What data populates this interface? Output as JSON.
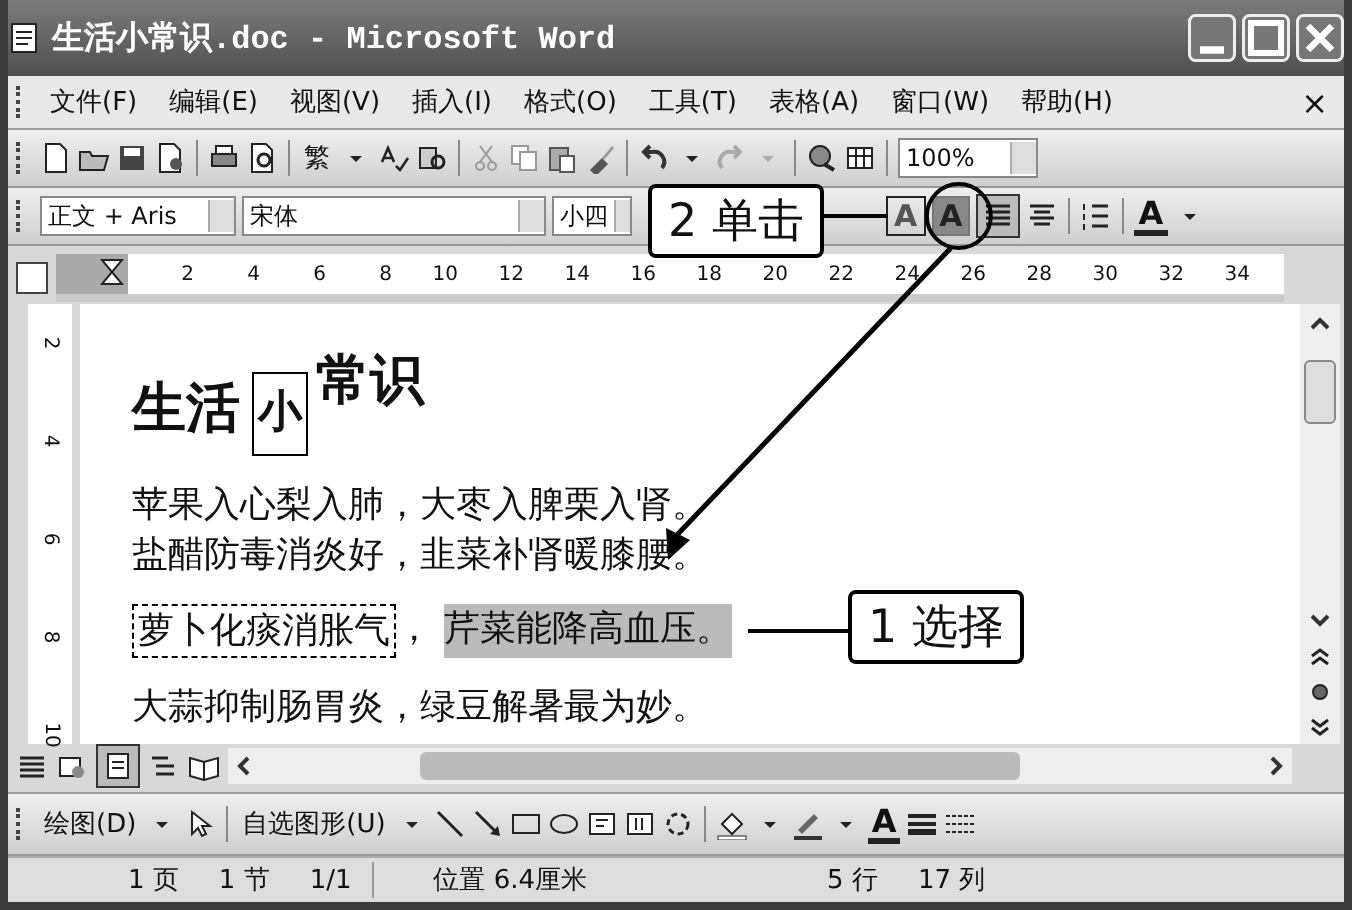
{
  "window": {
    "title": "生活小常识.doc - Microsoft Word"
  },
  "menu": {
    "items": [
      {
        "label": "文件(F)"
      },
      {
        "label": "编辑(E)"
      },
      {
        "label": "视图(V)"
      },
      {
        "label": "插入(I)"
      },
      {
        "label": "格式(O)"
      },
      {
        "label": "工具(T)"
      },
      {
        "label": "表格(A)"
      },
      {
        "label": "窗口(W)"
      },
      {
        "label": "帮助(H)"
      }
    ],
    "close": "×"
  },
  "standard_toolbar": {
    "convert_label": "繁",
    "zoom": "100%"
  },
  "formatting_toolbar": {
    "style": "正文 + Aris",
    "font": "宋体",
    "size": "小四",
    "buttons": [
      {
        "kind": "border",
        "label": "A"
      },
      {
        "kind": "shading",
        "label": "A"
      }
    ],
    "font_color_label": "A"
  },
  "ruler": {
    "ticks": [
      "2",
      "4",
      "6",
      "8",
      "10",
      "12",
      "14",
      "16",
      "18",
      "20",
      "22",
      "24",
      "26",
      "28",
      "30",
      "32",
      "34"
    ]
  },
  "vertical_ruler": {
    "ticks": [
      "2",
      "4",
      "6",
      "8",
      "10"
    ]
  },
  "document": {
    "heading": [
      {
        "kind": "plain",
        "text": "生活"
      },
      {
        "kind": "boxed",
        "text": "小"
      },
      {
        "kind": "raised",
        "text": "常识"
      }
    ],
    "lines": [
      [
        {
          "kind": "plain",
          "text": "苹果入心梨入肺，大枣入脾栗入肾。"
        }
      ],
      [
        {
          "kind": "plain",
          "text": "盐醋防毒消炎好，韭菜补肾暖膝腰。"
        }
      ],
      [
        {
          "kind": "dashed",
          "text": "萝卜化痰消胀气"
        },
        {
          "kind": "plain",
          "text": "，"
        },
        {
          "kind": "selected",
          "text": "芹菜能降高血压。"
        }
      ],
      [
        {
          "kind": "plain",
          "text": "大蒜抑制肠胃炎，绿豆解暑最为妙。"
        }
      ]
    ]
  },
  "drawing_toolbar": {
    "draw_menu": "绘图(D)",
    "autoshapes": "自选图形(U)",
    "font_color_label": "A"
  },
  "status_bar": {
    "items": [
      "1 页",
      "1 节",
      "1/1",
      "位置 6.4厘米",
      "5 行",
      "17 列"
    ]
  },
  "callouts": [
    {
      "kind": "click",
      "label": "2 单击"
    },
    {
      "kind": "select",
      "label": "1 选择"
    }
  ]
}
